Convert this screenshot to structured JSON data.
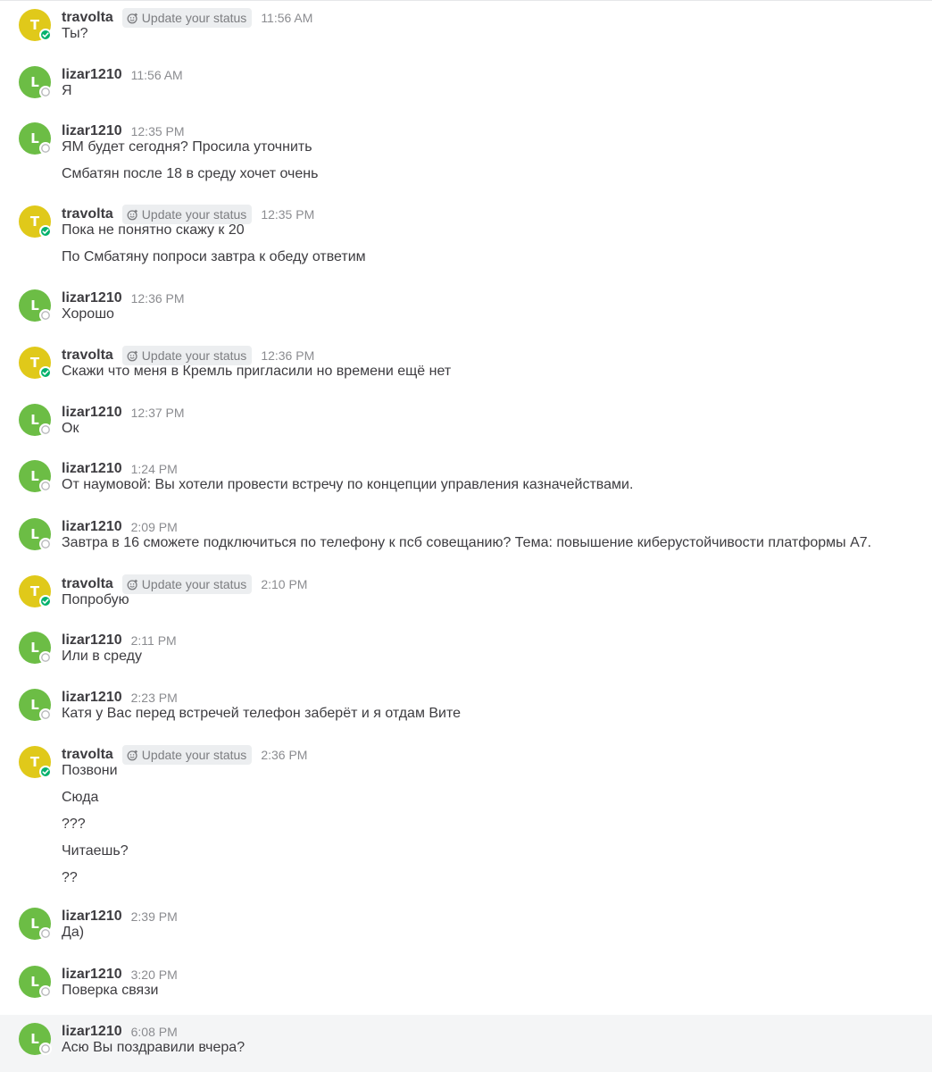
{
  "colors": {
    "travolta_avatar": "#e0c91a",
    "lizar_avatar": "#6cbd45",
    "online_status": "#06b26d",
    "hover_bg": "#f4f5f6"
  },
  "icons": {
    "status_icon": "smile-plus-icon",
    "online_icon": "check-icon"
  },
  "posts": [
    {
      "user": "travolta",
      "initial": "T",
      "status_btn": "Update your status",
      "time": "11:56 AM",
      "lines": [
        "Ты?"
      ]
    },
    {
      "user": "lizar1210",
      "initial": "L",
      "time": "11:56 AM",
      "lines": [
        "Я"
      ]
    },
    {
      "user": "lizar1210",
      "initial": "L",
      "time": "12:35 PM",
      "lines": [
        "ЯМ будет сегодня? Просила уточнить",
        "Смбатян после 18 в среду хочет очень"
      ]
    },
    {
      "user": "travolta",
      "initial": "T",
      "status_btn": "Update your status",
      "time": "12:35 PM",
      "lines": [
        "Пока не понятно скажу к 20",
        "По Смбатяну попроси завтра к обеду ответим"
      ]
    },
    {
      "user": "lizar1210",
      "initial": "L",
      "time": "12:36 PM",
      "lines": [
        "Хорошо"
      ]
    },
    {
      "user": "travolta",
      "initial": "T",
      "status_btn": "Update your status",
      "time": "12:36 PM",
      "lines": [
        "Скажи что меня в Кремль пригласили но времени ещё нет"
      ]
    },
    {
      "user": "lizar1210",
      "initial": "L",
      "time": "12:37 PM",
      "lines": [
        "Ок"
      ]
    },
    {
      "user": "lizar1210",
      "initial": "L",
      "time": "1:24 PM",
      "lines": [
        "От наумовой: Вы хотели провести встречу по концепции управления казначействами."
      ]
    },
    {
      "user": "lizar1210",
      "initial": "L",
      "time": "2:09 PM",
      "lines": [
        "Завтра в 16 сможете подключиться по телефону к псб совещанию? Тема: повышение киберустойчивости платформы А7."
      ]
    },
    {
      "user": "travolta",
      "initial": "T",
      "status_btn": "Update your status",
      "time": "2:10 PM",
      "lines": [
        "Попробую"
      ]
    },
    {
      "user": "lizar1210",
      "initial": "L",
      "time": "2:11 PM",
      "lines": [
        "Или в среду"
      ]
    },
    {
      "user": "lizar1210",
      "initial": "L",
      "time": "2:23 PM",
      "lines": [
        "Катя у Вас перед встречей телефон заберёт и я отдам Вите"
      ]
    },
    {
      "user": "travolta",
      "initial": "T",
      "status_btn": "Update your status",
      "time": "2:36 PM",
      "lines": [
        "Позвони",
        "Сюда",
        "???",
        "Читаешь?",
        "??"
      ]
    },
    {
      "user": "lizar1210",
      "initial": "L",
      "time": "2:39 PM",
      "lines": [
        "Да)"
      ]
    },
    {
      "user": "lizar1210",
      "initial": "L",
      "time": "3:20 PM",
      "lines": [
        "Поверка связи"
      ]
    },
    {
      "user": "lizar1210",
      "initial": "L",
      "time": "6:08 PM",
      "lines": [
        "Асю Вы поздравили вчера?"
      ],
      "hover": true
    }
  ]
}
